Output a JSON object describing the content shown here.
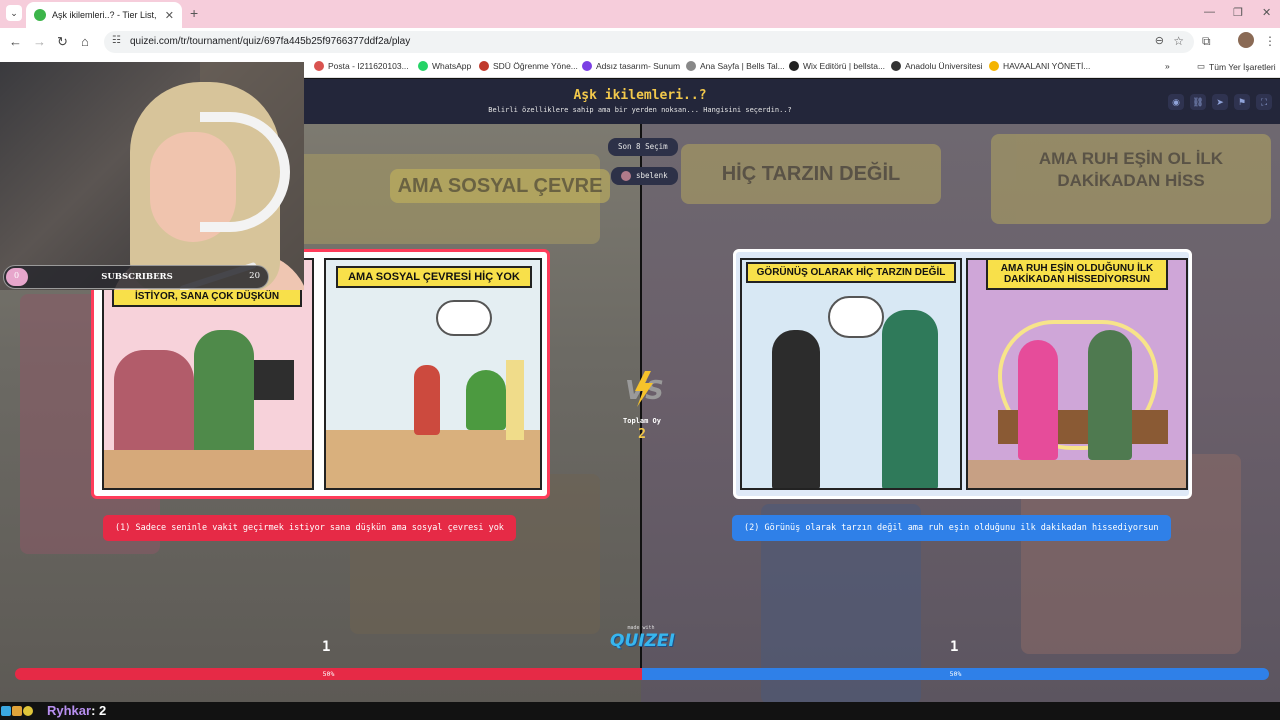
{
  "browser": {
    "tab_title": "Aşk ikilemleri..? - Tier List, Kör S",
    "url": "quizei.com/tr/tournament/quiz/697fa445b25f9766377ddf2a/play",
    "bookmarks": [
      {
        "label": "Posta - I211620103...",
        "color": "#d9534f"
      },
      {
        "label": "WhatsApp",
        "color": "#25d366"
      },
      {
        "label": "SDÜ Öğrenme Yöne...",
        "color": "#c0392b"
      },
      {
        "label": "Adsız tasarım- Sunum",
        "color": "#7b3fe4"
      },
      {
        "label": "Ana Sayfa | Bells Tal...",
        "color": "#888888"
      },
      {
        "label": "Wix Editörü | bellsta...",
        "color": "#222222"
      },
      {
        "label": "Anadolu Üniversitesi",
        "color": "#333333"
      },
      {
        "label": "HAVAALANI YÖNETİ...",
        "color": "#f4b400"
      }
    ],
    "all_bookmarks_label": "Tüm Yer İşaretleri"
  },
  "quiz": {
    "title": "Aşk ikilemleri..?",
    "subtitle": "Belirli özelliklere sahip ama bir yerden noksan... Hangisini seçerdin..?",
    "round_label": "Son 8 Seçim",
    "username": "sbelenk",
    "total_votes_label": "Toplam Oy",
    "total_votes": "2",
    "vs_text": "VS",
    "made_with": "made with",
    "brand": "QUIZEI"
  },
  "left": {
    "panel1_banner": "İSTİYOR, SANA ÇOK DÜŞKÜN",
    "panel2_banner": "AMA SOSYAL ÇEVRESİ HİÇ YOK",
    "caption": "(1) Sadece seninle vakit geçirmek istiyor sana düşkün ama sosyal çevresi yok",
    "votes": "1",
    "percent_label": "50%"
  },
  "right": {
    "panel1_banner": "GÖRÜNÜŞ OLARAK HİÇ TARZIN DEĞİL",
    "panel2_banner": "AMA RUH EŞİN OLDUĞUNU İLK DAKİKADAN HİSSEDİYORSUN",
    "caption": "(2) Görünüş olarak tarzın değil ama ruh eşin olduğunu ilk dakikadan hissediyorsun",
    "votes": "1",
    "percent_label": "50%"
  },
  "background_text": {
    "left": "AMA SOSYAL ÇEVRE",
    "right_mid": "HİÇ TARZIN DEĞİL",
    "right": "AMA RUH EŞİN OL İLK DAKİKADAN HİSS"
  },
  "vote_share": {
    "left": 0.5,
    "right": 0.5
  },
  "overlay": {
    "subs_label": "SUBSCRIBERS",
    "subs_current": "0",
    "subs_goal": "20"
  },
  "chat": {
    "user": "Ryhkar",
    "value": ": 2"
  },
  "colors": {
    "left_accent": "#e62a46",
    "right_accent": "#2f80e8",
    "title_yellow": "#f2c84b"
  }
}
